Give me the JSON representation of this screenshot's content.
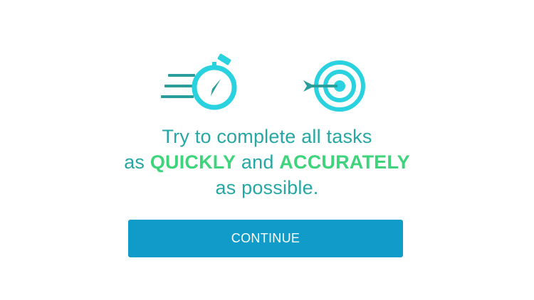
{
  "icons": {
    "left": "stopwatch-icon",
    "right": "target-icon"
  },
  "colors": {
    "icon_cyan": "#2ad2e0",
    "speed_lines": "#2a9e9d",
    "text_teal": "#26a7a4",
    "emphasis_green": "#3ed47b",
    "button_blue": "#109bc8",
    "button_text": "#ffffff",
    "background": "#ffffff"
  },
  "message": {
    "line1": "Try to complete all tasks",
    "line2_prefix": "as ",
    "line2_emph1": "QUICKLY",
    "line2_middle": " and ",
    "line2_emph2": "ACCURATELY",
    "line3": "as possible."
  },
  "button": {
    "label": "CONTINUE"
  }
}
